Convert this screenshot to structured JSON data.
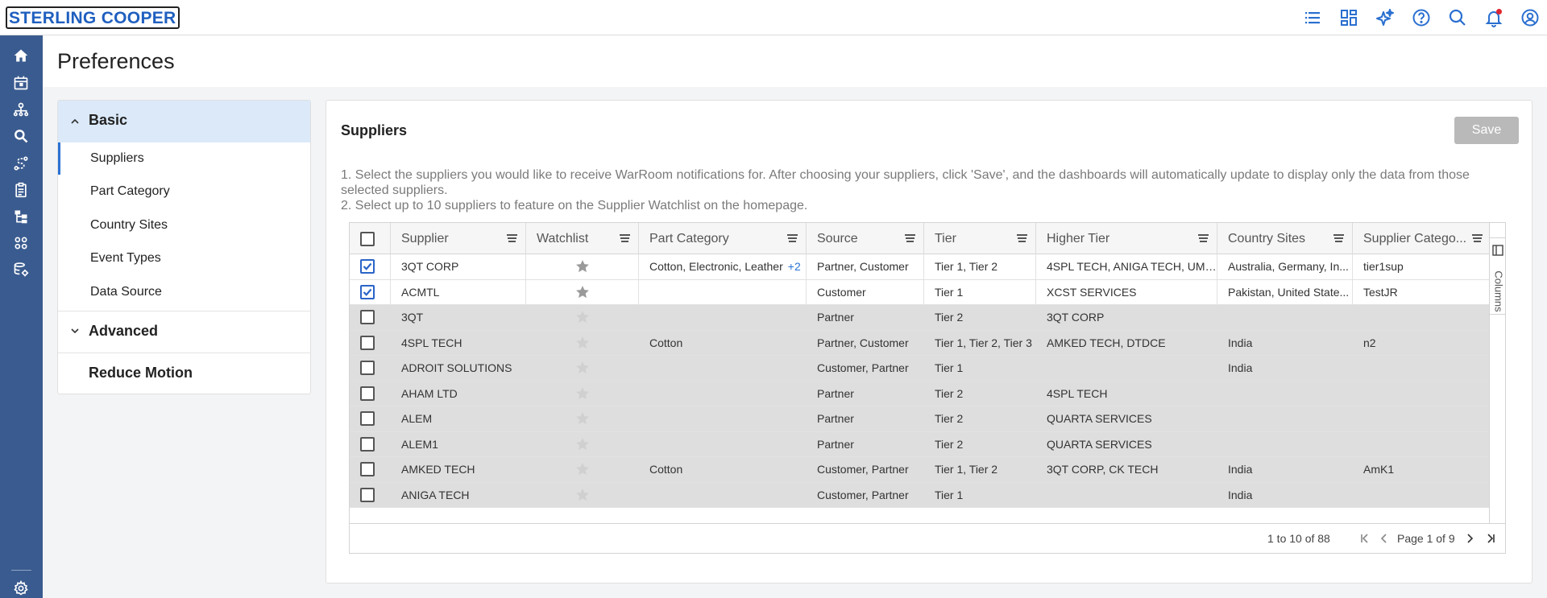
{
  "app": {
    "logo_text": "STERLING COOPER"
  },
  "page": {
    "title": "Preferences"
  },
  "left_panel": {
    "sections": [
      {
        "label": "Basic",
        "expanded": true
      },
      {
        "label": "Advanced",
        "expanded": false
      },
      {
        "label": "Reduce Motion"
      }
    ],
    "basic_items": [
      "Suppliers",
      "Part Category",
      "Country Sites",
      "Event Types",
      "Data Source"
    ],
    "active_item": "Suppliers"
  },
  "content": {
    "title": "Suppliers",
    "save_label": "Save",
    "instructions": [
      {
        "num": "1.",
        "text": "Select the suppliers you would like to receive WarRoom notifications for. After choosing your suppliers, click 'Save', and the dashboards will automatically update to display only the data from those selected suppliers."
      },
      {
        "num": "2.",
        "text": "Select up to 10 suppliers to feature on the Supplier Watchlist on the homepage."
      }
    ]
  },
  "grid": {
    "columns": [
      "Supplier",
      "Watchlist",
      "Part Category",
      "Source",
      "Tier",
      "Higher Tier",
      "Country Sites",
      "Supplier Catego..."
    ],
    "side_tab_label": "Columns",
    "rows": [
      {
        "checked": true,
        "supplier": "3QT CORP",
        "part_category": "Cotton, Electronic, Leather",
        "part_extra": "+2",
        "source": "Partner, Customer",
        "tier": "Tier 1, Tier 2",
        "higher_tier": "4SPL TECH, ANIGA TECH, UMB...",
        "country_sites": "Australia, Germany, In...",
        "supplier_category": "tier1sup"
      },
      {
        "checked": true,
        "supplier": "ACMTL",
        "part_category": "",
        "part_extra": "",
        "source": "Customer",
        "tier": "Tier 1",
        "higher_tier": "XCST SERVICES",
        "country_sites": "Pakistan, United State...",
        "supplier_category": "TestJR"
      },
      {
        "checked": false,
        "supplier": "3QT",
        "part_category": "",
        "part_extra": "",
        "source": "Partner",
        "tier": "Tier 2",
        "higher_tier": "3QT CORP",
        "country_sites": "",
        "supplier_category": ""
      },
      {
        "checked": false,
        "supplier": "4SPL TECH",
        "part_category": "Cotton",
        "part_extra": "",
        "source": "Partner, Customer",
        "tier": "Tier 1, Tier 2, Tier 3",
        "higher_tier": "AMKED TECH, DTDCE",
        "country_sites": "India",
        "supplier_category": "n2"
      },
      {
        "checked": false,
        "supplier": "ADROIT SOLUTIONS",
        "part_category": "",
        "part_extra": "",
        "source": "Customer, Partner",
        "tier": "Tier 1",
        "higher_tier": "",
        "country_sites": "India",
        "supplier_category": ""
      },
      {
        "checked": false,
        "supplier": "AHAM LTD",
        "part_category": "",
        "part_extra": "",
        "source": "Partner",
        "tier": "Tier 2",
        "higher_tier": "4SPL TECH",
        "country_sites": "",
        "supplier_category": ""
      },
      {
        "checked": false,
        "supplier": "ALEM",
        "part_category": "",
        "part_extra": "",
        "source": "Partner",
        "tier": "Tier 2",
        "higher_tier": "QUARTA SERVICES",
        "country_sites": "",
        "supplier_category": ""
      },
      {
        "checked": false,
        "supplier": "ALEM1",
        "part_category": "",
        "part_extra": "",
        "source": "Partner",
        "tier": "Tier 2",
        "higher_tier": "QUARTA SERVICES",
        "country_sites": "",
        "supplier_category": ""
      },
      {
        "checked": false,
        "supplier": "AMKED TECH",
        "part_category": "Cotton",
        "part_extra": "",
        "source": "Customer, Partner",
        "tier": "Tier 1, Tier 2",
        "higher_tier": "3QT CORP, CK TECH",
        "country_sites": "India",
        "supplier_category": "AmK1"
      },
      {
        "checked": false,
        "supplier": "ANIGA TECH",
        "part_category": "",
        "part_extra": "",
        "source": "Customer, Partner",
        "tier": "Tier 1",
        "higher_tier": "",
        "country_sites": "India",
        "supplier_category": ""
      }
    ],
    "pagination": {
      "range_text": "1 to 10 of 88",
      "page_text": "Page 1 of 9"
    }
  },
  "colors": {
    "accent": "#2a72d4",
    "rail": "#3a5b8f",
    "brand_text": "#1f5fbf",
    "selected_section_bg": "#dbe9f9",
    "disabled_row_bg": "#dedede",
    "notification_dot": "#e0262f"
  }
}
